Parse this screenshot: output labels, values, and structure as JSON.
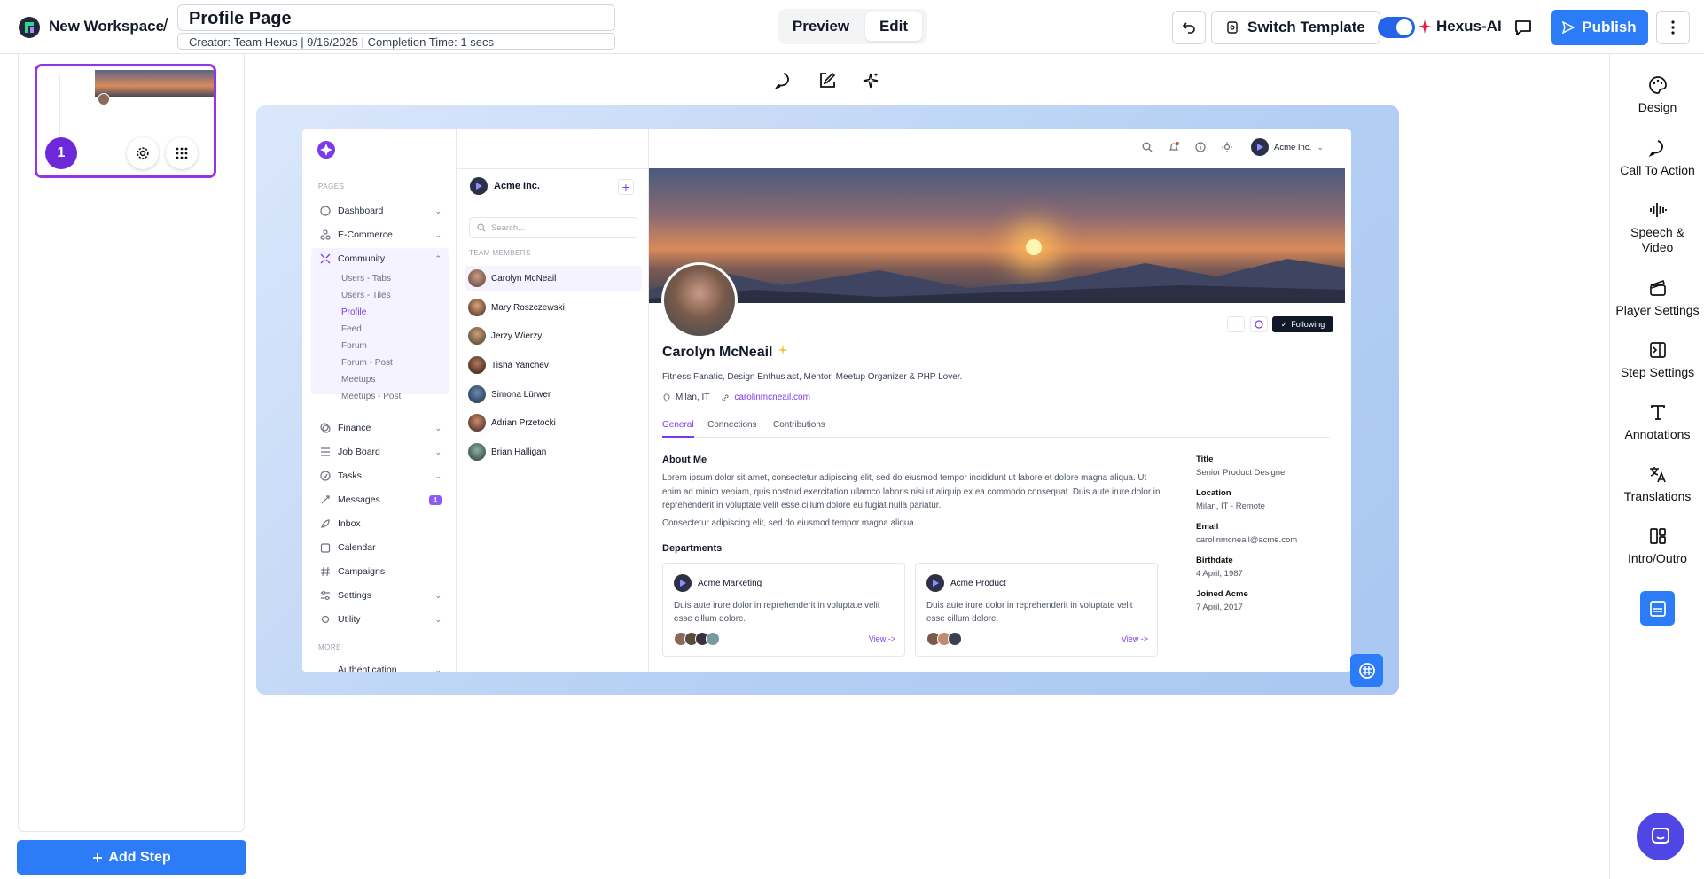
{
  "header": {
    "workspace": "New Workspace",
    "separator": "/",
    "title": "Profile Page",
    "subtitle": "Creator: Team Hexus | 9/16/2025 | Completion Time: 1 secs",
    "preview_label": "Preview",
    "edit_label": "Edit",
    "switch_template_label": "Switch Template",
    "hexus_ai_label": "Hexus-AI",
    "publish_label": "Publish"
  },
  "steps": {
    "step_number": "1",
    "add_step_label": "Add Step"
  },
  "right_rail": {
    "items": [
      {
        "label": "Design",
        "icon": "palette-icon"
      },
      {
        "label": "Call To Action",
        "icon": "chat-bubble-icon"
      },
      {
        "label": "Speech & Video",
        "icon": "audio-wave-icon"
      },
      {
        "label": "Player Settings",
        "icon": "clapperboard-icon"
      },
      {
        "label": "Step Settings",
        "icon": "panel-right-icon"
      },
      {
        "label": "Annotations",
        "icon": "text-t-icon"
      },
      {
        "label": "Translations",
        "icon": "translate-icon"
      },
      {
        "label": "Intro/Outro",
        "icon": "layout-icon"
      }
    ]
  },
  "app": {
    "nav": {
      "section_pages": "PAGES",
      "section_more": "MORE",
      "items": [
        {
          "label": "Dashboard"
        },
        {
          "label": "E-Commerce"
        },
        {
          "label": "Community"
        },
        {
          "label": "Finance"
        },
        {
          "label": "Job Board"
        },
        {
          "label": "Tasks"
        },
        {
          "label": "Messages",
          "badge": "4"
        },
        {
          "label": "Inbox"
        },
        {
          "label": "Calendar"
        },
        {
          "label": "Campaigns"
        },
        {
          "label": "Settings"
        },
        {
          "label": "Utility"
        }
      ],
      "community_sub": [
        "Users - Tabs",
        "Users - Tiles",
        "Profile",
        "Feed",
        "Forum",
        "Forum - Post",
        "Meetups",
        "Meetups - Post"
      ],
      "more_item": "Authentication"
    },
    "topbar": {
      "account": "Acme Inc."
    },
    "members": {
      "org": "Acme Inc.",
      "search_placeholder": "Search...",
      "section": "TEAM MEMBERS",
      "list": [
        "Carolyn McNeail",
        "Mary Roszczewski",
        "Jerzy Wierzy",
        "Tisha Yanchev",
        "Simona Lürwer",
        "Adrian Przetocki",
        "Brian Halligan"
      ]
    },
    "profile": {
      "name": "Carolyn McNeail",
      "bio": "Fitness Fanatic, Design Enthusiast, Mentor, Meetup Organizer & PHP Lover.",
      "location": "Milan, IT",
      "website": "carolinmcneail.com",
      "following_label": "Following",
      "tabs": [
        "General",
        "Connections",
        "Contributions"
      ],
      "about_title": "About Me",
      "about_p1": "Lorem ipsum dolor sit amet, consectetur adipiscing elit, sed do eiusmod tempor incididunt ut labore et dolore magna aliqua. Ut enim ad minim veniam, quis nostrud exercitation ullamco laboris nisi ut aliquip ex ea commodo consequat. Duis aute irure dolor in reprehenderit in voluptate velit esse cillum dolore eu fugiat nulla pariatur.",
      "about_p2": "Consectetur adipiscing elit, sed do eiusmod tempor magna aliqua.",
      "departments_title": "Departments",
      "departments": [
        {
          "name": "Acme Marketing",
          "desc": "Duis aute irure dolor in reprehenderit in voluptate velit esse cillum dolore.",
          "link": "View ->"
        },
        {
          "name": "Acme Product",
          "desc": "Duis aute irure dolor in reprehenderit in voluptate velit esse cillum dolore.",
          "link": "View ->"
        }
      ],
      "details": [
        {
          "label": "Title",
          "value": "Senior Product Designer"
        },
        {
          "label": "Location",
          "value": "Milan, IT - Remote"
        },
        {
          "label": "Email",
          "value": "carolinmcneail@acme.com"
        },
        {
          "label": "Birthdate",
          "value": "4 April, 1987"
        },
        {
          "label": "Joined Acme",
          "value": "7 April, 2017"
        }
      ]
    }
  },
  "colors": {
    "accent": "#2b7cf6",
    "purple": "#7c3aed",
    "step": "#6d28d9"
  }
}
